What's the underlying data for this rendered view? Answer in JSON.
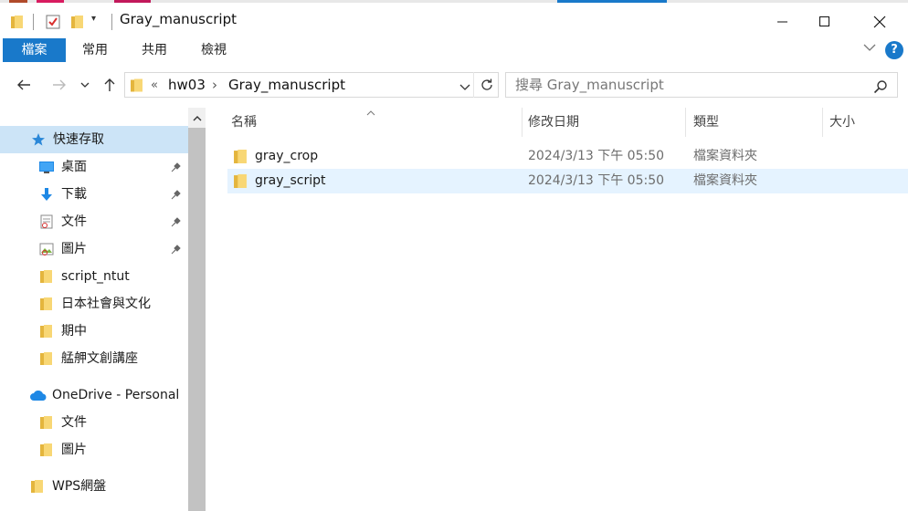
{
  "window": {
    "title": "Gray_manuscript",
    "controls": {
      "minimize_icon": "minimize-icon",
      "maximize_icon": "maximize-icon",
      "close_icon": "close-icon"
    }
  },
  "colors": {
    "accent": "#1979ca",
    "selection_nav": "#cce4f7",
    "selection_row": "#e5f3ff",
    "folder": "#f8d775",
    "help": "#1979ca"
  },
  "ribbon": {
    "tabs": [
      {
        "label": "檔案",
        "active": true
      },
      {
        "label": "常用",
        "active": false
      },
      {
        "label": "共用",
        "active": false
      },
      {
        "label": "檢視",
        "active": false
      }
    ],
    "help_label": "?"
  },
  "address": {
    "overflow": "«",
    "breadcrumbs": [
      "hw03",
      "Gray_manuscript"
    ],
    "separator": "›"
  },
  "search": {
    "placeholder": "搜尋 Gray_manuscript"
  },
  "nav": {
    "quick_access": {
      "label": "快速存取",
      "icon": "star-icon"
    },
    "items": [
      {
        "label": "桌面",
        "icon": "desktop-icon",
        "pinned": true
      },
      {
        "label": "下載",
        "icon": "download-icon",
        "pinned": true
      },
      {
        "label": "文件",
        "icon": "document-icon",
        "pinned": true
      },
      {
        "label": "圖片",
        "icon": "picture-icon",
        "pinned": true
      },
      {
        "label": "script_ntut",
        "icon": "folder-icon",
        "pinned": false
      },
      {
        "label": "日本社會與文化",
        "icon": "folder-icon",
        "pinned": false
      },
      {
        "label": "期中",
        "icon": "folder-icon",
        "pinned": false
      },
      {
        "label": "艋舺文創講座",
        "icon": "folder-icon",
        "pinned": false
      }
    ],
    "onedrive": {
      "label": "OneDrive - Personal",
      "icon": "cloud-icon",
      "items": [
        {
          "label": "文件",
          "icon": "folder-icon"
        },
        {
          "label": "圖片",
          "icon": "folder-icon"
        }
      ]
    },
    "wps": {
      "label": "WPS網盤",
      "icon": "folder-icon"
    }
  },
  "columns": {
    "name": "名稱",
    "modified": "修改日期",
    "type": "類型",
    "size": "大小"
  },
  "files": [
    {
      "name": "gray_crop",
      "modified": "2024/3/13 下午 05:50",
      "type": "檔案資料夾",
      "size": ""
    },
    {
      "name": "gray_script",
      "modified": "2024/3/13 下午 05:50",
      "type": "檔案資料夾",
      "size": ""
    }
  ]
}
